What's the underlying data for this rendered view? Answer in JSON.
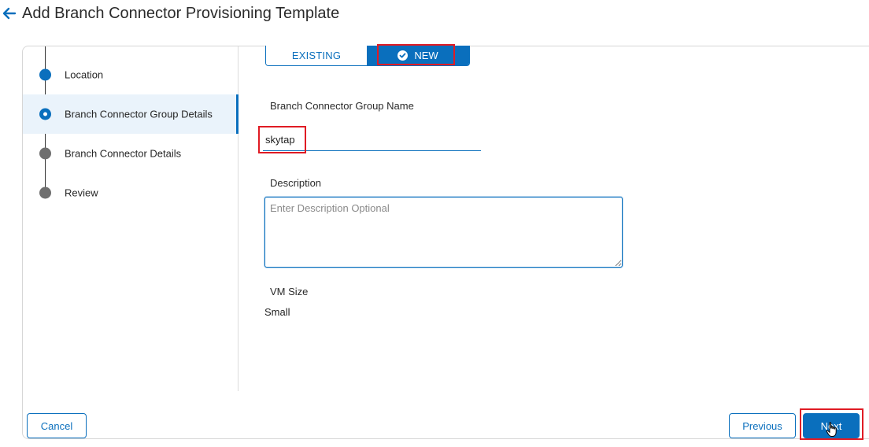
{
  "header": {
    "back_icon": "arrow-left-icon",
    "title": "Add Branch Connector Provisioning Template"
  },
  "stepper": {
    "steps": [
      {
        "label": "Location",
        "state": "done"
      },
      {
        "label": "Branch Connector Group Details",
        "state": "current"
      },
      {
        "label": "Branch Connector Details",
        "state": "pending"
      },
      {
        "label": "Review",
        "state": "pending"
      }
    ]
  },
  "group_mode": {
    "options": [
      "EXISTING",
      "NEW"
    ],
    "selected": "NEW",
    "selected_icon": "check-circle-icon"
  },
  "form": {
    "group_name_label": "Branch Connector Group Name",
    "group_name_value": "skytap",
    "description_label": "Description",
    "description_placeholder": "Enter Description Optional",
    "vm_size_label": "VM Size",
    "vm_size_value": "Small"
  },
  "footer": {
    "cancel_label": "Cancel",
    "previous_label": "Previous",
    "next_label": "Next"
  },
  "colors": {
    "accent": "#0a6fbd",
    "highlight": "#e01b24",
    "pending_step": "#6f6f6f"
  }
}
